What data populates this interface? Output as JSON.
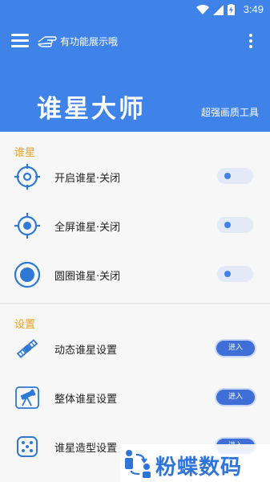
{
  "status_bar": {
    "time": "3:49",
    "icons": [
      "wifi-icon",
      "signal-icon",
      "battery-charging-icon"
    ]
  },
  "header": {
    "tagline": "有功能展示哦",
    "title": "谁星大师",
    "subtitle": "超强画质工具"
  },
  "sections": {
    "crosshair": {
      "title": "谁星",
      "items": [
        {
          "label": "开启谁星·关闭",
          "icon": "crosshair-icon",
          "toggle": "off"
        },
        {
          "label": "全屏谁星·关闭",
          "icon": "fullscreen-crosshair-icon",
          "toggle": "off"
        },
        {
          "label": "圆圈谁星·关闭",
          "icon": "circle-crosshair-icon",
          "toggle": "off"
        }
      ]
    },
    "settings": {
      "title": "设置",
      "items": [
        {
          "label": "动态谁星设置",
          "icon": "satellite-icon",
          "button": "进入"
        },
        {
          "label": "整体谁星设置",
          "icon": "telescope-icon",
          "button": "进入"
        },
        {
          "label": "谁星造型设置",
          "icon": "dice-icon",
          "button": "进入"
        }
      ]
    }
  },
  "watermark": {
    "text": "粉蝶数码"
  },
  "colors": {
    "primary": "#3f83e8",
    "section_title": "#e5a320",
    "button": "#3f6fd6"
  }
}
